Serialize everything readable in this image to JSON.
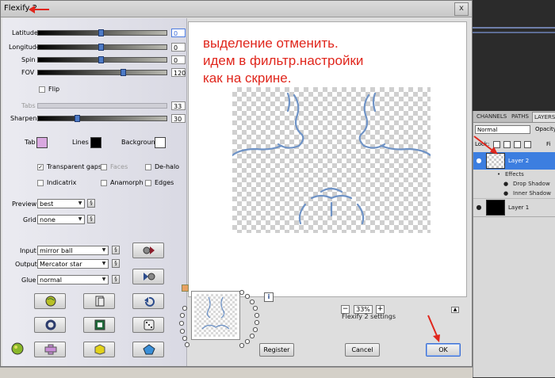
{
  "dialog": {
    "title": "Flexify 2",
    "close_label": "x"
  },
  "sliders": [
    {
      "label": "Latitude",
      "value": "0",
      "level_pct": 49
    },
    {
      "label": "Longitude",
      "value": "0",
      "level_pct": 49
    },
    {
      "label": "Spin",
      "value": "0",
      "level_pct": 49
    },
    {
      "label": "FOV",
      "value": "120",
      "level_pct": 66
    }
  ],
  "flip_label": "Flip",
  "tabs_slider": {
    "label": "Tabs",
    "value": "33"
  },
  "sharpen_slider": {
    "label": "Sharpen",
    "value": "30",
    "level_pct": 30
  },
  "colors": {
    "tab_label": "Tab",
    "tab_color": "#d9a8e0",
    "lines_label": "Lines",
    "lines_color": "#000000",
    "background_label": "Background",
    "background_color": "#ffffff",
    "accent": "#e0261c"
  },
  "checkboxes": {
    "transparent_gaps": "Transparent gaps",
    "faces": "Faces",
    "de_halo": "De-halo",
    "indicatrix": "Indicatrix",
    "anamorph": "Anamorph",
    "edges": "Edges",
    "checkmark": "✓"
  },
  "preview": {
    "label": "Preview",
    "value": "best"
  },
  "grid": {
    "label": "Grid",
    "value": "none"
  },
  "input": {
    "label": "Input",
    "value": "mirror ball"
  },
  "output": {
    "label": "Output",
    "value": "Mercator star"
  },
  "glue": {
    "label": "Glue",
    "value": "normal"
  },
  "link_glyph": "§",
  "note_lines": [
    "выделение отменить.",
    "идем в фильтр.настройки",
    "как на скрине."
  ],
  "zoom": {
    "minus": "−",
    "value": "33%",
    "plus": "+"
  },
  "settings_label": "Flexify 2 settings",
  "info_label": "i",
  "buttons": {
    "register": "Register",
    "cancel": "Cancel",
    "ok": "OK"
  },
  "layers_panel": {
    "tabs": [
      "CHANNELS",
      "PATHS",
      "LAYERS"
    ],
    "blend_mode": "Normal",
    "opacity_label": "Opacity",
    "lock_label": "Lock:",
    "fill_label": "Fi",
    "layers": [
      {
        "name": "Layer 2",
        "selected": true
      },
      {
        "name": "Effects"
      },
      {
        "name": "Drop Shadow"
      },
      {
        "name": "Inner Shadow"
      },
      {
        "name": "Layer 1"
      }
    ]
  }
}
